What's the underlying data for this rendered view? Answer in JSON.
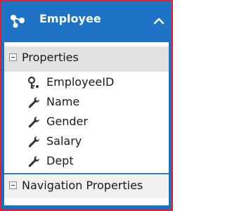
{
  "entity": {
    "title": "Employee",
    "icon": "entity-icon",
    "collapse_icon": "chevron-up-icon"
  },
  "sections": {
    "properties": {
      "label": "Properties",
      "toggle_icon": "collapse-minus-icon"
    },
    "navigation": {
      "label": "Navigation Properties",
      "toggle_icon": "collapse-minus-icon"
    }
  },
  "properties": [
    {
      "label": "EmployeeID",
      "icon": "key-icon"
    },
    {
      "label": "Name",
      "icon": "wrench-icon"
    },
    {
      "label": "Gender",
      "icon": "wrench-icon"
    },
    {
      "label": "Salary",
      "icon": "wrench-icon"
    },
    {
      "label": "Dept",
      "icon": "wrench-icon"
    }
  ],
  "colors": {
    "header": "#1f73c7",
    "frame_border": "#e8202a",
    "section_header": "#e2e2e2"
  }
}
